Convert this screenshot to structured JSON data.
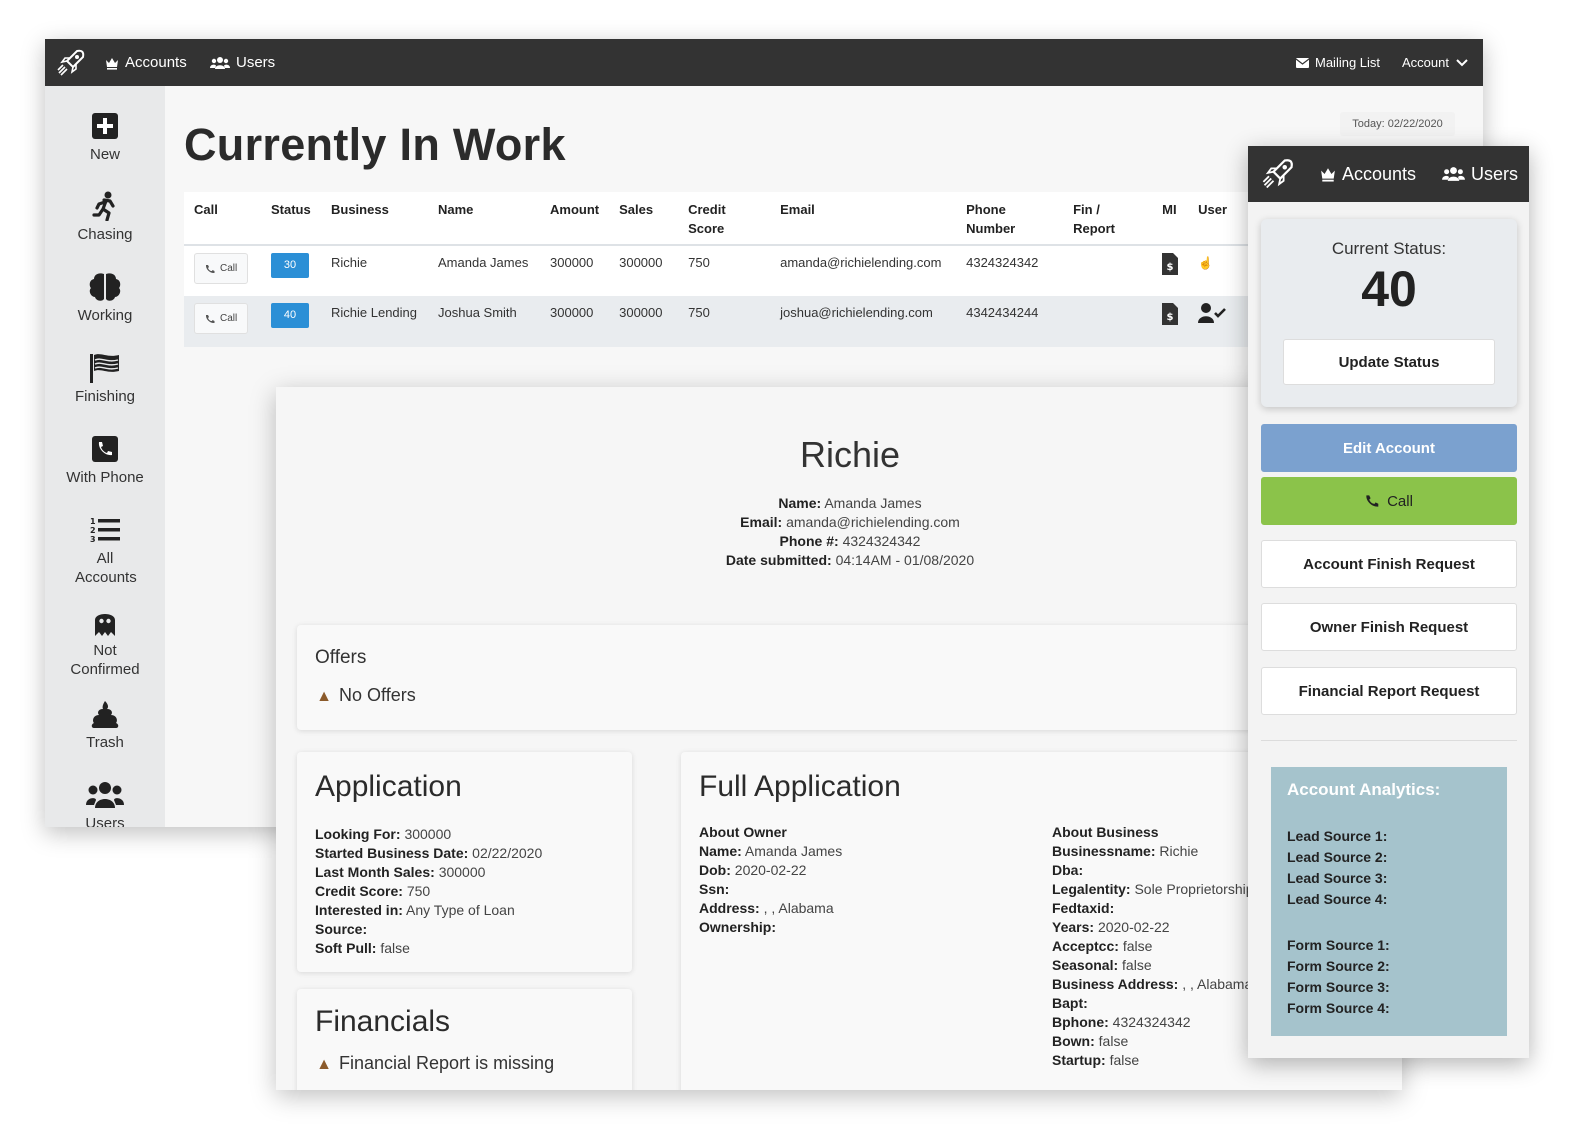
{
  "topnav": {
    "accounts": "Accounts",
    "users": "Users",
    "mailing_list": "Mailing List",
    "account": "Account"
  },
  "sidebar": {
    "items": [
      {
        "icon": "plus-square-icon",
        "label": "New"
      },
      {
        "icon": "running-icon",
        "label": "Chasing"
      },
      {
        "icon": "brain-icon",
        "label": "Working"
      },
      {
        "icon": "flag-icon",
        "label": "Finishing"
      },
      {
        "icon": "phone-square-icon",
        "label": "With Phone"
      },
      {
        "icon": "list-ol-icon",
        "label": "All Accounts"
      },
      {
        "icon": "ghost-icon",
        "label": "Not Confirmed"
      },
      {
        "icon": "poop-icon",
        "label": "Trash"
      },
      {
        "icon": "users-icon",
        "label": "Users"
      }
    ]
  },
  "today": "Today: 02/22/2020",
  "page_title": "Currently In Work",
  "table": {
    "headers": [
      "Call",
      "Status",
      "Business",
      "Name",
      "Amount",
      "Sales",
      "Credit Score",
      "Email",
      "Phone Number",
      "Fin / Report",
      "MI",
      "User"
    ],
    "rows": [
      {
        "call": "Call",
        "status": "30",
        "business": "Richie",
        "name": "Amanda James",
        "amount": "300000",
        "sales": "300000",
        "credit": "750",
        "email": "amanda@richielending.com",
        "phone": "4324324342",
        "fin": ""
      },
      {
        "call": "Call",
        "status": "40",
        "business": "Richie Lending",
        "name": "Joshua Smith",
        "amount": "300000",
        "sales": "300000",
        "credit": "750",
        "email": "joshua@richielending.com",
        "phone": "4342434244",
        "fin": ""
      }
    ]
  },
  "detail": {
    "business_name": "Richie",
    "name_label": "Name:",
    "name": "Amanda James",
    "email_label": "Email:",
    "email": "amanda@richielending.com",
    "phone_label": "Phone #:",
    "phone": "4324324342",
    "date_label": "Date submitted:",
    "date": "04:14AM - 01/08/2020",
    "offers_title": "Offers",
    "offers_empty": "No Offers",
    "application": {
      "title": "Application",
      "fields": [
        {
          "label": "Looking For:",
          "value": "300000"
        },
        {
          "label": "Started Business Date:",
          "value": "02/22/2020"
        },
        {
          "label": "Last Month Sales:",
          "value": "300000"
        },
        {
          "label": "Credit Score:",
          "value": "750"
        },
        {
          "label": "Interested in:",
          "value": "Any Type of Loan"
        },
        {
          "label": "Source:",
          "value": ""
        },
        {
          "label": "Soft Pull:",
          "value": "false"
        }
      ]
    },
    "financials": {
      "title": "Financials",
      "missing": "Financial Report is missing"
    },
    "full_application": {
      "title": "Full Application",
      "owner_heading": "About Owner",
      "owner_fields": [
        {
          "label": "Name:",
          "value": "Amanda James"
        },
        {
          "label": "Dob:",
          "value": "2020-02-22"
        },
        {
          "label": "Ssn:",
          "value": ""
        },
        {
          "label": "Address:",
          "value": ", , Alabama"
        },
        {
          "label": "Ownership:",
          "value": ""
        }
      ],
      "business_heading": "About Business",
      "business_fields": [
        {
          "label": "Businessname:",
          "value": "Richie"
        },
        {
          "label": "Dba:",
          "value": ""
        },
        {
          "label": "Legalentity:",
          "value": "Sole Proprietorship"
        },
        {
          "label": "Fedtaxid:",
          "value": ""
        },
        {
          "label": "Years:",
          "value": "2020-02-22"
        },
        {
          "label": "Acceptcc:",
          "value": "false"
        },
        {
          "label": "Seasonal:",
          "value": "false"
        },
        {
          "label": "Business Address:",
          "value": ", , Alabama"
        },
        {
          "label": "Bapt:",
          "value": ""
        },
        {
          "label": "Bphone:",
          "value": "4324324342"
        },
        {
          "label": "Bown:",
          "value": "false"
        },
        {
          "label": "Startup:",
          "value": "false"
        }
      ]
    }
  },
  "panel": {
    "accounts": "Accounts",
    "users": "Users",
    "current_status_label": "Current Status:",
    "current_status_value": "40",
    "update_status": "Update Status",
    "edit_account": "Edit Account",
    "call": "Call",
    "account_finish": "Account Finish Request",
    "owner_finish": "Owner Finish Request",
    "financial_report": "Financial Report Request",
    "analytics_title": "Account Analytics:",
    "lead_sources": [
      "Lead Source 1:",
      "Lead Source 2:",
      "Lead Source 3:",
      "Lead Source 4:"
    ],
    "form_sources": [
      "Form Source 1:",
      "Form Source 2:",
      "Form Source 3:",
      "Form Source 4:"
    ]
  },
  "colors": {
    "topbar": "#333333",
    "status_badge": "#2b8fd6",
    "edit_button": "#7ba1cf",
    "call_button": "#8bc34a",
    "analytics_bg": "#a5c3cc"
  }
}
